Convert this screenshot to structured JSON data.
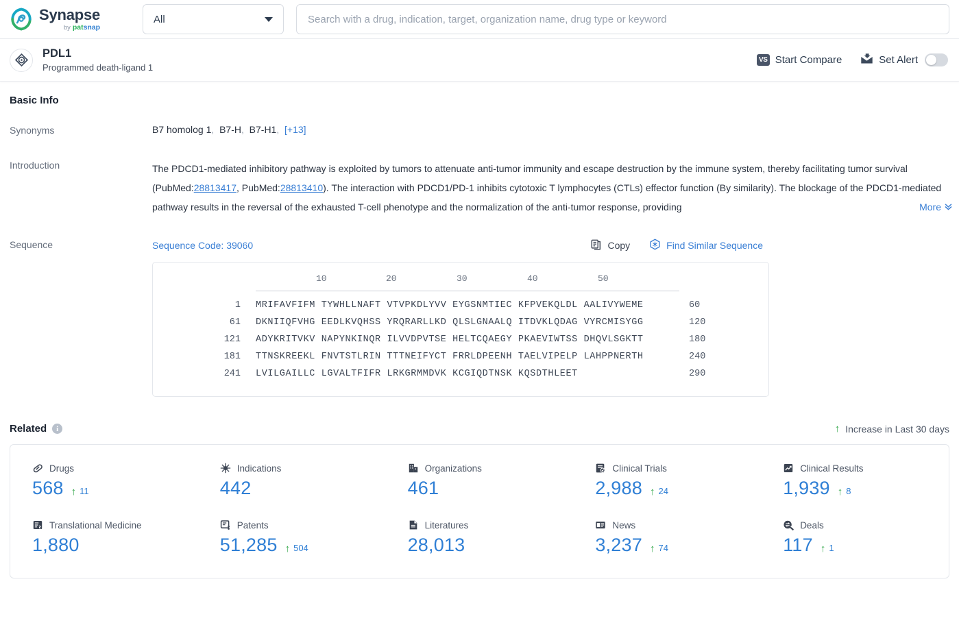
{
  "header": {
    "logo": {
      "title": "Synapse",
      "by": "by",
      "pat": "pat",
      "snap": "snap",
      "icon": "synapse-logo-icon"
    },
    "filter_select": {
      "value": "All",
      "icon": "chevron-down-icon"
    },
    "search": {
      "value": "",
      "placeholder": "Search with a drug, indication, target, organization name, drug type or keyword"
    }
  },
  "entity": {
    "icon": "target-icon",
    "title": "PDL1",
    "subtitle": "Programmed death-ligand 1",
    "actions": {
      "compare": {
        "label": "Start Compare",
        "badge": "VS",
        "icon": "vs-icon"
      },
      "alert": {
        "label": "Set Alert",
        "icon": "alert-mail-icon",
        "toggle_on": false
      }
    }
  },
  "basic_info": {
    "section_title": "Basic Info",
    "synonyms": {
      "label": "Synonyms",
      "items": [
        "B7 homolog 1",
        "B7-H",
        "B7-H1"
      ],
      "more": "[+13]"
    },
    "introduction": {
      "label": "Introduction",
      "part1": "The PDCD1-mediated inhibitory pathway is exploited by tumors to attenuate anti-tumor immunity and escape destruction by the immune system, thereby facilitating tumor survival (PubMed:",
      "pubmed1": "28813417",
      "part2": ", PubMed:",
      "pubmed2": "28813410",
      "part3": "). The interaction with PDCD1/PD-1 inhibits cytotoxic T lymphocytes (CTLs) effector function (By similarity). The blockage of the PDCD1-mediated pathway results in the reversal of the exhausted T-cell phenotype and the normalization of the anti-tumor response, providing",
      "more_label": "More",
      "more_icon": "chevron-double-down-icon"
    },
    "sequence": {
      "label": "Sequence",
      "code_label": "Sequence Code: 39060",
      "copy_label": "Copy",
      "copy_icon": "copy-icon",
      "find_label": "Find Similar Sequence",
      "find_icon": "find-similar-icon",
      "ruler": [
        "10",
        "20",
        "30",
        "40",
        "50"
      ],
      "rows": [
        {
          "start": "1",
          "blocks": [
            "MRIFAVFIFM",
            "TYWHLLNAFT",
            "VTVPKDLYVV",
            "EYGSNMTIEC",
            "KFPVEKQLDL",
            "AALIVYWEME"
          ],
          "end": "60"
        },
        {
          "start": "61",
          "blocks": [
            "DKNIIQFVHG",
            "EEDLKVQHSS",
            "YRQRARLLKD",
            "QLSLGNAALQ",
            "ITDVKLQDAG",
            "VYRCMISYGG"
          ],
          "end": "120"
        },
        {
          "start": "121",
          "blocks": [
            "ADYKRITVKV",
            "NAPYNKINQR",
            "ILVVDPVTSE",
            "HELTCQAEGY",
            "PKAEVIWTSS",
            "DHQVLSGKTT"
          ],
          "end": "180"
        },
        {
          "start": "181",
          "blocks": [
            "TTNSKREEKL",
            "FNVTSTLRIN",
            "TTTNEIFYCT",
            "FRRLDPEENH",
            "TAELVIPELP",
            "LAHPPNERTH"
          ],
          "end": "240"
        },
        {
          "start": "241",
          "blocks": [
            "LVILGAILLC",
            "LGVALTFIFR",
            "LRKGRMMDVK",
            "KCGIQDTNSK",
            "KQSDTHLEET",
            ""
          ],
          "end": "290"
        }
      ]
    }
  },
  "related": {
    "title": "Related",
    "info_icon": "info-icon",
    "legend": {
      "arrow": "arrow-up-icon",
      "label": "Increase in Last 30 days"
    },
    "cards": [
      {
        "label": "Drugs",
        "icon": "pill-icon",
        "value": "568",
        "delta": "11"
      },
      {
        "label": "Indications",
        "icon": "virus-icon",
        "value": "442",
        "delta": ""
      },
      {
        "label": "Organizations",
        "icon": "building-icon",
        "value": "461",
        "delta": ""
      },
      {
        "label": "Clinical Trials",
        "icon": "trial-icon",
        "value": "2,988",
        "delta": "24"
      },
      {
        "label": "Clinical Results",
        "icon": "results-icon",
        "value": "1,939",
        "delta": "8"
      },
      {
        "label": "Translational Medicine",
        "icon": "translational-icon",
        "value": "1,880",
        "delta": ""
      },
      {
        "label": "Patents",
        "icon": "patent-icon",
        "value": "51,285",
        "delta": "504"
      },
      {
        "label": "Literatures",
        "icon": "literature-icon",
        "value": "28,013",
        "delta": ""
      },
      {
        "label": "News",
        "icon": "news-icon",
        "value": "3,237",
        "delta": "74"
      },
      {
        "label": "Deals",
        "icon": "deals-icon",
        "value": "117",
        "delta": "1"
      }
    ]
  },
  "colors": {
    "accent_blue": "#2f7fd5",
    "link_blue": "#3a7fd5",
    "green": "#35a84c",
    "text_dark": "#1b2330"
  }
}
